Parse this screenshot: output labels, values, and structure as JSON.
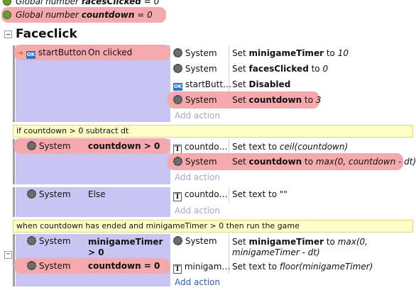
{
  "globals": [
    {
      "prefix": "Global number ",
      "name": "facesClicked",
      "suffix": " = 0"
    },
    {
      "prefix": "Global number ",
      "name": "countdown",
      "suffix": " = 0"
    }
  ],
  "group": {
    "title": "Faceclick",
    "toggle": "−"
  },
  "events": [
    {
      "conditions": [
        {
          "icon": "ok-icon",
          "object": "startButton",
          "text": "On clicked"
        }
      ],
      "actions": [
        {
          "icon": "gear-icon",
          "object": "System",
          "pre": "Set ",
          "bold": "minigameTimer",
          "mid": " to ",
          "ital": "10"
        },
        {
          "icon": "gear-icon",
          "object": "System",
          "pre": "Set ",
          "bold": "facesClicked",
          "mid": " to ",
          "ital": "0"
        },
        {
          "icon": "ok-icon",
          "object": "startButt…",
          "pre": "Set ",
          "bold": "Disabled",
          "mid": "",
          "ital": ""
        },
        {
          "icon": "gear-icon",
          "object": "System",
          "pre": "Set ",
          "bold": "countdown",
          "mid": " to ",
          "ital": "3"
        }
      ],
      "add_action": "Add action"
    },
    {
      "comment": "if countdown > 0 subtract dt",
      "conditions": [
        {
          "icon": "gear-icon",
          "object": "System",
          "text": "countdown > 0"
        }
      ],
      "actions": [
        {
          "icon": "text-icon",
          "object": "countdo…",
          "pre": "Set text to ",
          "bold": "",
          "mid": "",
          "ital": "ceil(countdown)"
        },
        {
          "icon": "gear-icon",
          "object": "System",
          "pre": "Set ",
          "bold": "countdown",
          "mid": " to ",
          "ital": "max(0, countdown - dt)"
        }
      ],
      "add_action": "Add action"
    },
    {
      "conditions": [
        {
          "icon": "gear-icon",
          "object": "System",
          "text": "Else"
        }
      ],
      "actions": [
        {
          "icon": "text-icon",
          "object": "countdo…",
          "pre": "Set text to ",
          "bold": "",
          "mid": "",
          "ital": "\"\""
        }
      ],
      "add_action": "Add action"
    },
    {
      "comment": "when countdown has ended and minigameTimer > 0 then run the game",
      "conditions": [
        {
          "icon": "gear-icon",
          "object": "System",
          "text": "minigameTimer > 0"
        },
        {
          "icon": "gear-icon",
          "object": "System",
          "text": "countdown = 0"
        }
      ],
      "actions": [
        {
          "icon": "gear-icon",
          "object": "System",
          "pre": "Set ",
          "bold": "minigameTimer",
          "mid": " to ",
          "ital": "max(0, minigameTimer - dt)"
        },
        {
          "icon": "text-icon",
          "object": "minigam…",
          "pre": "Set text to ",
          "bold": "",
          "mid": "",
          "ital": "floor(minigameTimer)"
        }
      ],
      "add_action": "Add action"
    }
  ],
  "icons": {
    "ok_label": "OK",
    "text_label": "T",
    "collapse_label": "−"
  }
}
